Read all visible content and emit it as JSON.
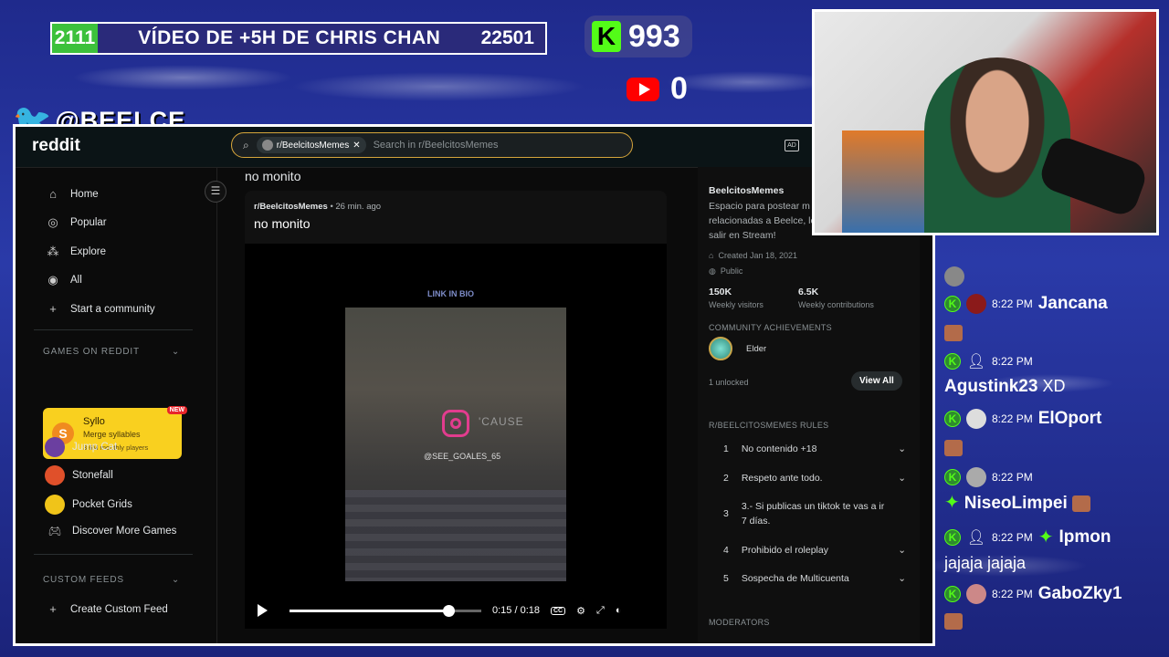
{
  "overlay": {
    "banner_left": "2111",
    "banner_title": "VÍDEO DE +5H DE CHRIS CHAN",
    "banner_right": "22501",
    "kick_letter": "K",
    "kick_count": "993",
    "youtube_count": "0",
    "twitter_handle": "@BEELCE_",
    "colors": {
      "kick_green": "#53fc18",
      "youtube_red": "#ff0000",
      "background_blue": "#2a3aa8"
    }
  },
  "reddit": {
    "logo": "reddit",
    "search": {
      "chip": "r/BeelcitosMemes",
      "placeholder": "Search in r/BeelcitosMemes"
    },
    "nav": [
      {
        "label": "Home",
        "icon": "home-icon"
      },
      {
        "label": "Popular",
        "icon": "popular-icon"
      },
      {
        "label": "Explore",
        "icon": "explore-icon"
      },
      {
        "label": "All",
        "icon": "all-icon"
      },
      {
        "label": "Start a community",
        "icon": "plus-icon"
      }
    ],
    "games_header": "GAMES ON REDDIT",
    "featured_game": {
      "name": "Syllo",
      "tagline": "Merge syllables",
      "players": "3.6M monthly players",
      "badge": "NEW"
    },
    "games": [
      "Jump Cat",
      "Stonefall",
      "Pocket Grids",
      "Discover More Games"
    ],
    "custom_feeds_header": "CUSTOM FEEDS",
    "create_feed": "Create Custom Feed",
    "post": {
      "top_title": "no monito",
      "subreddit": "r/BeelcitosMemes",
      "time": "• 26 min. ago",
      "title": "no monito",
      "video_overlay_link": "LINK IN BIO",
      "video_overlay_cause": "'CAUSE",
      "video_overlay_handle": "@SEE_GOALES_65",
      "time_display": "0:15 / 0:18",
      "progress": 0.83
    },
    "sidebar": {
      "name": "BeelcitosMemes",
      "desc_lines": [
        "Espacio para postear m",
        "relacionadas a Beelce, lo",
        "salir en Stream!"
      ],
      "created": "Created Jan 18, 2021",
      "visibility": "Public",
      "stat1_value": "150K",
      "stat1_label": "Weekly visitors",
      "stat2_value": "6.5K",
      "stat2_label": "Weekly contributions",
      "achievements_header": "COMMUNITY ACHIEVEMENTS",
      "achievement": "Elder",
      "unlocked": "1 unlocked",
      "view_all": "View All",
      "rules_header": "R/BEELCITOSMEMES RULES",
      "rules": [
        {
          "num": "1",
          "text": "No contenido +18"
        },
        {
          "num": "2",
          "text": "Respeto ante todo."
        },
        {
          "num": "3",
          "text": "3.- Si publicas un tiktok te vas a ir",
          "text2": "7 días."
        },
        {
          "num": "4",
          "text": "Prohibido el roleplay"
        },
        {
          "num": "5",
          "text": "Sospecha de Multicuenta"
        }
      ],
      "moderators_header": "MODERATORS"
    }
  },
  "chat": [
    {
      "time": "8:22 PM",
      "user": "Jancana"
    },
    {
      "time": "8:22 PM",
      "user": "Agustink23",
      "text": "XD"
    },
    {
      "time": "8:22 PM",
      "user": "ElOport"
    },
    {
      "time": "8:22 PM",
      "user": "NiseoLimpei"
    },
    {
      "time": "8:22 PM",
      "user": "Ipmon",
      "text": "jajaja jajaja"
    },
    {
      "time": "8:22 PM",
      "user": "GaboZky1"
    }
  ]
}
